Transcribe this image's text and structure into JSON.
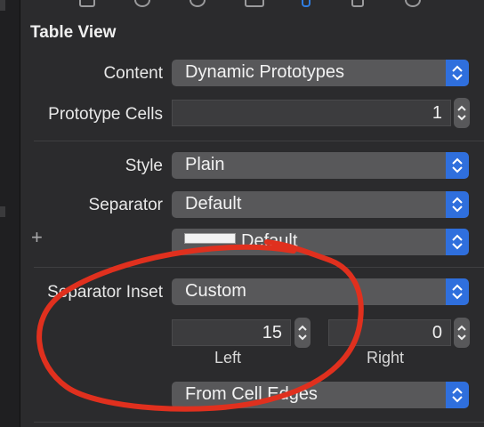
{
  "section": {
    "title": "Table View"
  },
  "content": {
    "label": "Content",
    "value": "Dynamic Prototypes"
  },
  "prototype_cells": {
    "label": "Prototype Cells",
    "value": "1"
  },
  "style": {
    "label": "Style",
    "value": "Plain"
  },
  "separator": {
    "label": "Separator",
    "value": "Default"
  },
  "separator_color": {
    "value": "Default"
  },
  "separator_inset": {
    "label": "Separator Inset",
    "value": "Custom"
  },
  "inset_left": {
    "value": "15",
    "caption": "Left"
  },
  "inset_right": {
    "value": "0",
    "caption": "Right"
  },
  "inset_reference": {
    "value": "From Cell Edges"
  },
  "colors": {
    "accent": "#2f6fdd",
    "annotation": "#e0301e",
    "background": "#2b2b2d",
    "popup": "#58585a"
  },
  "icons": {
    "add": "+",
    "popup_chevron": "updown-chevron-icon",
    "stepper": "stepper-icon"
  }
}
